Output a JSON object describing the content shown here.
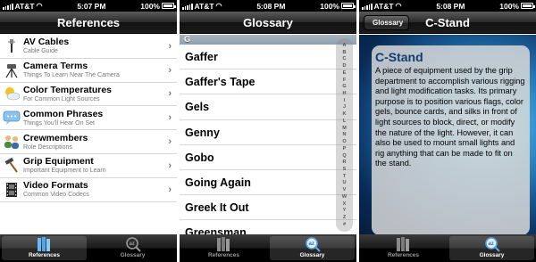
{
  "status": {
    "carrier": "AT&T",
    "battery": "100%",
    "times": [
      "5:07 PM",
      "5:08 PM",
      "5:08 PM"
    ]
  },
  "screens": {
    "references": {
      "title": "References",
      "items": [
        {
          "title": "AV Cables",
          "subtitle": "Cable Guide",
          "icon": "cable-icon"
        },
        {
          "title": "Camera Terms",
          "subtitle": "Things To Learn Near The Camera",
          "icon": "tripod-icon"
        },
        {
          "title": "Color Temperatures",
          "subtitle": "For Common Light Sources",
          "icon": "sun-cloud-icon"
        },
        {
          "title": "Common Phrases",
          "subtitle": "Things You'll Hear On Set",
          "icon": "speech-bubble-icon"
        },
        {
          "title": "Crewmembers",
          "subtitle": "Role Descriptions",
          "icon": "people-icon"
        },
        {
          "title": "Grip Equipment",
          "subtitle": "Important Equipment to Learn",
          "icon": "hammer-icon"
        },
        {
          "title": "Video Formats",
          "subtitle": "Common Video Codecs",
          "icon": "film-icon"
        }
      ]
    },
    "glossary": {
      "title": "Glossary",
      "section": "G",
      "terms": [
        "Gaffer",
        "Gaffer's Tape",
        "Gels",
        "Genny",
        "Gobo",
        "Going Again",
        "Greek It Out",
        "Greensman"
      ],
      "index": [
        "A",
        "B",
        "C",
        "D",
        "E",
        "F",
        "G",
        "H",
        "I",
        "J",
        "K",
        "L",
        "M",
        "N",
        "O",
        "P",
        "Q",
        "R",
        "S",
        "T",
        "U",
        "V",
        "W",
        "X",
        "Y",
        "Z",
        "#"
      ]
    },
    "detail": {
      "title": "C-Stand",
      "back_label": "Glossary",
      "heading": "C-Stand",
      "body": "A piece of equipment used by the grip department to accomplish various rigging and light modification tasks. Its primary purpose is to position various flags, color gels, bounce cards, and silks in front of light sources to block, direct, or modify the nature of the light. However, it can also be used to mount small lights and rig anything that can be made to fit on the stand."
    }
  },
  "tabs": [
    {
      "label": "References",
      "icon": "books-icon"
    },
    {
      "label": "Glossary",
      "icon": "az-magnifier-icon"
    }
  ],
  "colors": {
    "section_header": "#97a6b7",
    "detail_heading": "#123c6e",
    "active_tab": "#ffffff"
  }
}
